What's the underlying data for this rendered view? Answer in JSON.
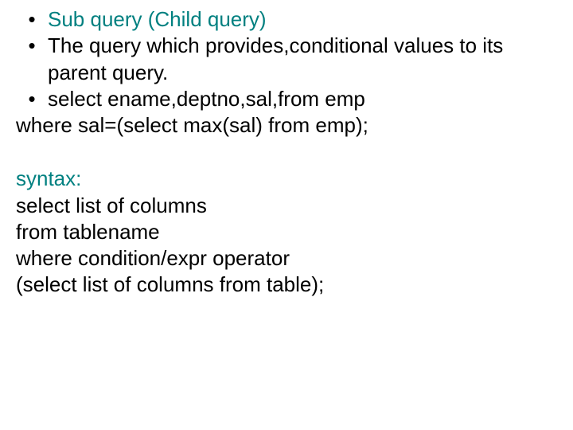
{
  "bullets": {
    "b1": "Sub query (Child query)",
    "b2": "The query which provides,conditional values to its parent query.",
    "b3": "select ename,deptno,sal,from emp"
  },
  "lines": {
    "where1": "where sal=(select max(sal) from emp);",
    "syntax": "syntax:",
    "s1": " select list of columns",
    "s2": "from tablename",
    "s3": "where condition/expr operator",
    "s4": "(select list of columns from table);"
  }
}
